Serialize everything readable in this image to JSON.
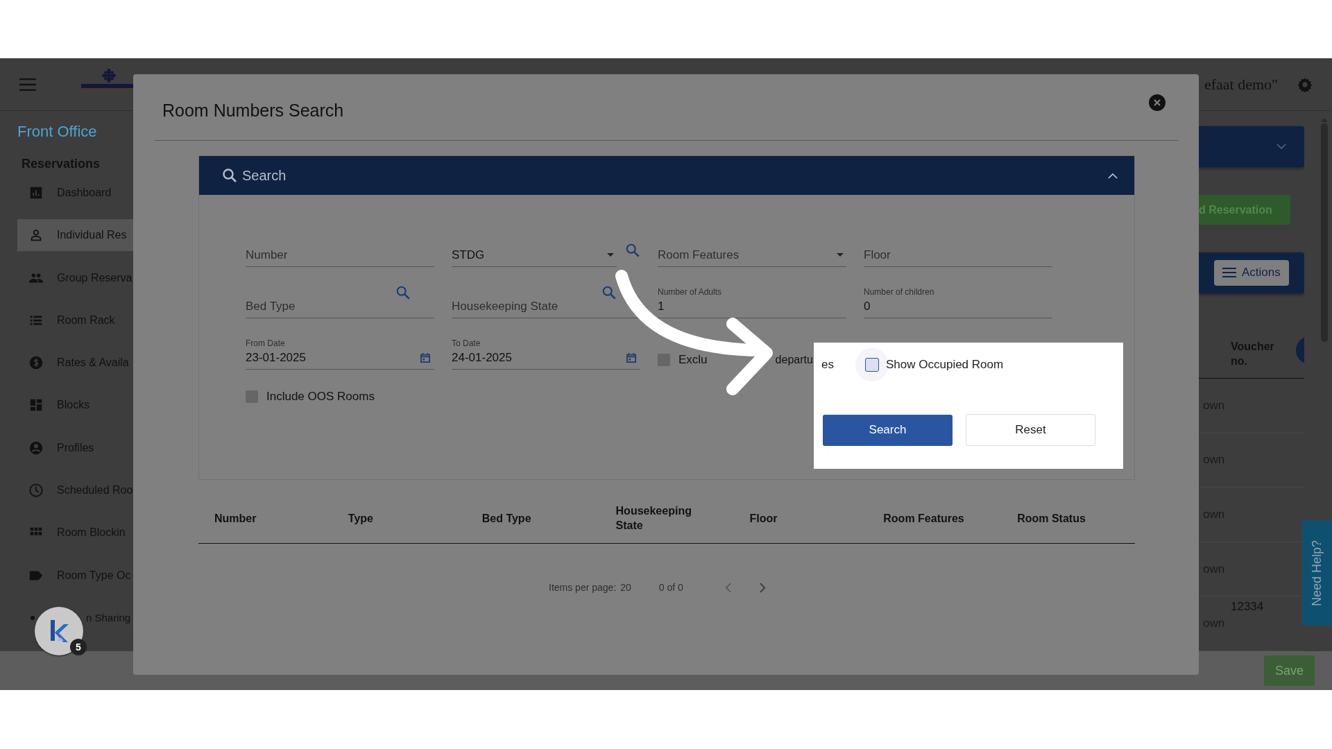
{
  "app": {
    "header": {
      "user": "efaat demo\""
    },
    "sidebar": {
      "title": "Front Office",
      "section": "Reservations",
      "items": [
        {
          "label": "Dashboard",
          "kind": "chart",
          "selected": false
        },
        {
          "label": "Individual Res",
          "kind": "person",
          "selected": true
        },
        {
          "label": "Group Reserva",
          "kind": "group",
          "selected": false
        },
        {
          "label": "Room Rack",
          "kind": "list",
          "selected": false
        },
        {
          "label": "Rates & Availa",
          "kind": "dollar",
          "selected": false
        },
        {
          "label": "Blocks",
          "kind": "blocks",
          "selected": false
        },
        {
          "label": "Profiles",
          "kind": "account",
          "selected": false
        },
        {
          "label": "Scheduled Roo",
          "kind": "clock",
          "selected": false
        },
        {
          "label": "Room Blockin",
          "kind": "grid",
          "selected": false
        },
        {
          "label": "Room Type Oc",
          "kind": "tag",
          "selected": false
        },
        {
          "label": "n Sharing",
          "kind": "share",
          "selected": false
        }
      ]
    },
    "page": {
      "add_button": "d Reservation",
      "actions_button": "Actions",
      "voucher_header": "Voucher no.",
      "rows": [
        {
          "column_1": "own"
        },
        {
          "column_1": "own"
        },
        {
          "column_1": "own"
        },
        {
          "column_1": "own"
        },
        {
          "column_1": "own",
          "voucher": "12334"
        }
      ]
    },
    "save_button": "Save"
  },
  "dialog": {
    "title": "Room Numbers Search",
    "search_panel": {
      "title": "Search",
      "expanded": true
    },
    "fields": [
      {
        "kind": "text",
        "placeholder": "Number"
      },
      {
        "kind": "select-search",
        "value": "STDG"
      },
      {
        "kind": "select",
        "placeholder": "Room Features"
      },
      {
        "kind": "text",
        "placeholder": "Floor"
      },
      {
        "kind": "lookup",
        "placeholder": "Bed Type"
      },
      {
        "kind": "lookup",
        "placeholder": "Housekeeping State"
      },
      {
        "kind": "labeled",
        "label": "Number of Adults",
        "value": "1"
      },
      {
        "kind": "labeled",
        "label": "Number of children",
        "value": "0"
      },
      {
        "kind": "date",
        "label": "From Date",
        "value": "23-01-2025"
      },
      {
        "kind": "date",
        "label": "To Date",
        "value": "24-01-2025"
      }
    ],
    "exclude": {
      "checked": false,
      "parts": [
        "Exclu",
        "departu",
        "es"
      ]
    },
    "include_oos": {
      "label": "Include OOS Rooms",
      "checked": false
    },
    "show_occupied": {
      "label": "Show Occupied Room",
      "checked": false
    },
    "buttons": [
      "Search",
      "Reset"
    ],
    "table": {
      "columns": [
        "Number",
        "Type",
        "Bed Type",
        "Housekeeping State",
        "Floor",
        "Room Features",
        "Room Status"
      ]
    },
    "paginator": {
      "items_per_page_label": "Items per page:",
      "items_per_page": "20",
      "range": "0 of 0"
    }
  },
  "tutorial": {
    "badge": "5"
  },
  "help_tab": "Need Help?"
}
